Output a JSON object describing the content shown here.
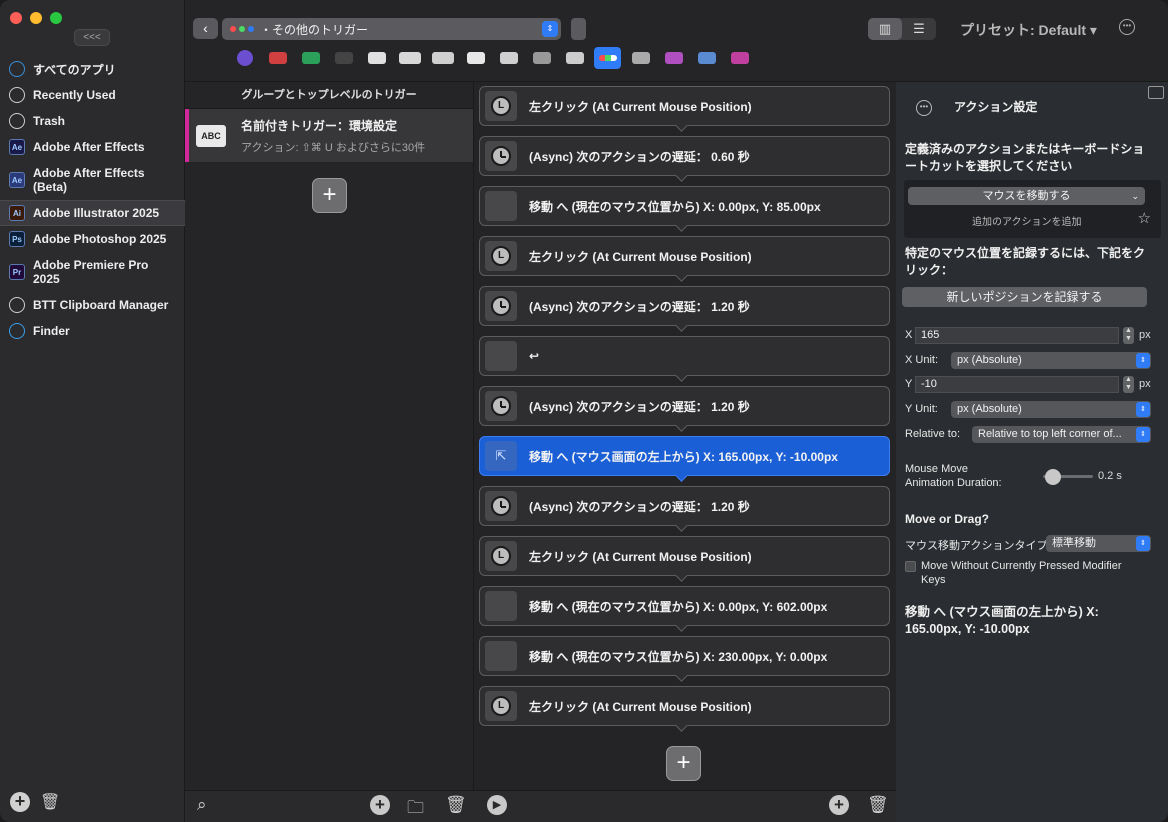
{
  "window": {
    "traffic_colors": [
      "#ff5f57",
      "#febc2e",
      "#28c840"
    ]
  },
  "sidebar": {
    "collapse_label": "<<<",
    "apps": [
      {
        "label": "すべてのアプリ",
        "icon": "globe-icon",
        "icon_text": "",
        "icon_color": "#3a8fd6"
      },
      {
        "label": "Recently Used",
        "icon": "clock-icon",
        "icon_text": "",
        "icon_color": "#cfcfcf"
      },
      {
        "label": "Trash",
        "icon": "trash-icon",
        "icon_text": "",
        "icon_color": "#cfcfcf"
      },
      {
        "label": "Adobe After Effects",
        "icon": "after-effects-icon",
        "icon_text": "Ae",
        "icon_color": "#1a1a4a"
      },
      {
        "label": "Adobe After Effects (Beta)",
        "icon": "after-effects-beta-icon",
        "icon_text": "Ae",
        "icon_color": "#2a3a7a"
      },
      {
        "label": "Adobe Illustrator 2025",
        "icon": "illustrator-icon",
        "icon_text": "Ai",
        "icon_color": "#3a1a0a"
      },
      {
        "label": "Adobe Photoshop 2025",
        "icon": "photoshop-icon",
        "icon_text": "Ps",
        "icon_color": "#0a1f3a"
      },
      {
        "label": "Adobe Premiere Pro 2025",
        "icon": "premiere-icon",
        "icon_text": "Pr",
        "icon_color": "#1f0a3a"
      },
      {
        "label": "BTT Clipboard Manager",
        "icon": "clipboard-icon",
        "icon_text": "",
        "icon_color": "#cfcfcf"
      },
      {
        "label": "Finder",
        "icon": "finder-icon",
        "icon_text": "",
        "icon_color": "#3a9ee8"
      }
    ],
    "selected_index": 5
  },
  "topbar": {
    "trigger_type": "その他のトリガー",
    "preset_label": "プリセット: Default ▾",
    "device_icons": [
      "siri-icon",
      "touchbar-icon",
      "stream-deck-icon",
      "keyboard-grid-icon",
      "magic-mouse-icon",
      "trackpad-icon",
      "keyboard-icon",
      "key-sequence-icon",
      "mouse-icon",
      "remote-icon",
      "drawing-icon",
      "other-triggers-icon",
      "midi-icon",
      "gesture-icon",
      "automation-icon",
      "menubar-icon"
    ]
  },
  "groups": {
    "header": "グループとトップレベルのトリガー",
    "item": {
      "title": "名前付きトリガー：環境設定",
      "subtitle": "アクション: ⇧⌘ U およびさらに30件",
      "icon_text": "ABC"
    }
  },
  "actions": [
    {
      "text": "左クリック (At Current Mouse Position)",
      "icon": "left-click-icon",
      "selected": false
    },
    {
      "text": "(Async) 次のアクションの遅延： 0.60 秒",
      "icon": "delay-clock-icon",
      "selected": false
    },
    {
      "text": "移動 へ (現在のマウス位置から) X: 0.00px, Y: 85.00px",
      "icon": "move-mouse-icon",
      "selected": false
    },
    {
      "text": "左クリック (At Current Mouse Position)",
      "icon": "left-click-icon",
      "selected": false
    },
    {
      "text": "(Async) 次のアクションの遅延： 1.20 秒",
      "icon": "delay-clock-icon",
      "selected": false
    },
    {
      "text": "↩",
      "icon": "return-key-icon",
      "selected": false
    },
    {
      "text": "(Async) 次のアクションの遅延： 1.20 秒",
      "icon": "delay-clock-icon",
      "selected": false
    },
    {
      "text": "移動 へ (マウス画面の左上から) X: 165.00px, Y: -10.00px",
      "icon": "move-mouse-icon",
      "selected": true
    },
    {
      "text": "(Async) 次のアクションの遅延： 1.20 秒",
      "icon": "delay-clock-icon",
      "selected": false
    },
    {
      "text": "左クリック (At Current Mouse Position)",
      "icon": "left-click-icon",
      "selected": false
    },
    {
      "text": "移動 へ (現在のマウス位置から) X: 0.00px, Y: 602.00px",
      "icon": "move-mouse-icon",
      "selected": false
    },
    {
      "text": "移動 へ (現在のマウス位置から) X: 230.00px, Y: 0.00px",
      "icon": "move-mouse-icon",
      "selected": false
    },
    {
      "text": "左クリック (At Current Mouse Position)",
      "icon": "left-click-icon",
      "selected": false
    }
  ],
  "right_panel": {
    "title": "アクション設定",
    "choose_label": "定義済みのアクションまたはキーボードショートカットを選択してください",
    "action_select": "マウスを移動する",
    "add_action": "追加のアクションを追加",
    "record_hint": "特定のマウス位置を記録するには、下記をクリック：",
    "record_button": "新しいポジションを記録する",
    "x_label": "X",
    "x_value": "165",
    "x_unit_suffix": "px",
    "x_unit_label": "X Unit:",
    "x_unit_value": "px (Absolute)",
    "y_label": "Y",
    "y_value": "-10",
    "y_unit_suffix": "px",
    "y_unit_label": "Y Unit:",
    "y_unit_value": "px (Absolute)",
    "relative_label": "Relative to:",
    "relative_value": "Relative to top left corner of...",
    "anim_label_1": "Mouse Move",
    "anim_label_2": "Animation Duration:",
    "anim_value": "0.2 s",
    "move_or_drag": "Move or Drag?",
    "move_type_label": "マウス移動アクションタイプ",
    "move_type_value": "標準移動",
    "modifier_label_1": "Move Without Currently Pressed Modifier",
    "modifier_label_2": "Keys",
    "summary": "移動 へ (マウス画面の左上から) X: 165.00px, Y: -10.00px"
  }
}
